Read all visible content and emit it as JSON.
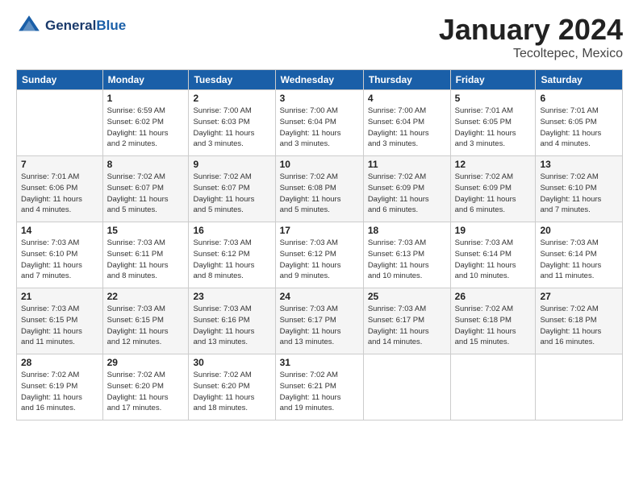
{
  "header": {
    "logo_line1": "General",
    "logo_line2": "Blue",
    "month": "January 2024",
    "location": "Tecoltepec, Mexico"
  },
  "days_of_week": [
    "Sunday",
    "Monday",
    "Tuesday",
    "Wednesday",
    "Thursday",
    "Friday",
    "Saturday"
  ],
  "weeks": [
    [
      {
        "day": "",
        "info": ""
      },
      {
        "day": "1",
        "info": "Sunrise: 6:59 AM\nSunset: 6:02 PM\nDaylight: 11 hours\nand 2 minutes."
      },
      {
        "day": "2",
        "info": "Sunrise: 7:00 AM\nSunset: 6:03 PM\nDaylight: 11 hours\nand 3 minutes."
      },
      {
        "day": "3",
        "info": "Sunrise: 7:00 AM\nSunset: 6:04 PM\nDaylight: 11 hours\nand 3 minutes."
      },
      {
        "day": "4",
        "info": "Sunrise: 7:00 AM\nSunset: 6:04 PM\nDaylight: 11 hours\nand 3 minutes."
      },
      {
        "day": "5",
        "info": "Sunrise: 7:01 AM\nSunset: 6:05 PM\nDaylight: 11 hours\nand 3 minutes."
      },
      {
        "day": "6",
        "info": "Sunrise: 7:01 AM\nSunset: 6:05 PM\nDaylight: 11 hours\nand 4 minutes."
      }
    ],
    [
      {
        "day": "7",
        "info": "Sunrise: 7:01 AM\nSunset: 6:06 PM\nDaylight: 11 hours\nand 4 minutes."
      },
      {
        "day": "8",
        "info": "Sunrise: 7:02 AM\nSunset: 6:07 PM\nDaylight: 11 hours\nand 5 minutes."
      },
      {
        "day": "9",
        "info": "Sunrise: 7:02 AM\nSunset: 6:07 PM\nDaylight: 11 hours\nand 5 minutes."
      },
      {
        "day": "10",
        "info": "Sunrise: 7:02 AM\nSunset: 6:08 PM\nDaylight: 11 hours\nand 5 minutes."
      },
      {
        "day": "11",
        "info": "Sunrise: 7:02 AM\nSunset: 6:09 PM\nDaylight: 11 hours\nand 6 minutes."
      },
      {
        "day": "12",
        "info": "Sunrise: 7:02 AM\nSunset: 6:09 PM\nDaylight: 11 hours\nand 6 minutes."
      },
      {
        "day": "13",
        "info": "Sunrise: 7:02 AM\nSunset: 6:10 PM\nDaylight: 11 hours\nand 7 minutes."
      }
    ],
    [
      {
        "day": "14",
        "info": "Sunrise: 7:03 AM\nSunset: 6:10 PM\nDaylight: 11 hours\nand 7 minutes."
      },
      {
        "day": "15",
        "info": "Sunrise: 7:03 AM\nSunset: 6:11 PM\nDaylight: 11 hours\nand 8 minutes."
      },
      {
        "day": "16",
        "info": "Sunrise: 7:03 AM\nSunset: 6:12 PM\nDaylight: 11 hours\nand 8 minutes."
      },
      {
        "day": "17",
        "info": "Sunrise: 7:03 AM\nSunset: 6:12 PM\nDaylight: 11 hours\nand 9 minutes."
      },
      {
        "day": "18",
        "info": "Sunrise: 7:03 AM\nSunset: 6:13 PM\nDaylight: 11 hours\nand 10 minutes."
      },
      {
        "day": "19",
        "info": "Sunrise: 7:03 AM\nSunset: 6:14 PM\nDaylight: 11 hours\nand 10 minutes."
      },
      {
        "day": "20",
        "info": "Sunrise: 7:03 AM\nSunset: 6:14 PM\nDaylight: 11 hours\nand 11 minutes."
      }
    ],
    [
      {
        "day": "21",
        "info": "Sunrise: 7:03 AM\nSunset: 6:15 PM\nDaylight: 11 hours\nand 11 minutes."
      },
      {
        "day": "22",
        "info": "Sunrise: 7:03 AM\nSunset: 6:15 PM\nDaylight: 11 hours\nand 12 minutes."
      },
      {
        "day": "23",
        "info": "Sunrise: 7:03 AM\nSunset: 6:16 PM\nDaylight: 11 hours\nand 13 minutes."
      },
      {
        "day": "24",
        "info": "Sunrise: 7:03 AM\nSunset: 6:17 PM\nDaylight: 11 hours\nand 13 minutes."
      },
      {
        "day": "25",
        "info": "Sunrise: 7:03 AM\nSunset: 6:17 PM\nDaylight: 11 hours\nand 14 minutes."
      },
      {
        "day": "26",
        "info": "Sunrise: 7:02 AM\nSunset: 6:18 PM\nDaylight: 11 hours\nand 15 minutes."
      },
      {
        "day": "27",
        "info": "Sunrise: 7:02 AM\nSunset: 6:18 PM\nDaylight: 11 hours\nand 16 minutes."
      }
    ],
    [
      {
        "day": "28",
        "info": "Sunrise: 7:02 AM\nSunset: 6:19 PM\nDaylight: 11 hours\nand 16 minutes."
      },
      {
        "day": "29",
        "info": "Sunrise: 7:02 AM\nSunset: 6:20 PM\nDaylight: 11 hours\nand 17 minutes."
      },
      {
        "day": "30",
        "info": "Sunrise: 7:02 AM\nSunset: 6:20 PM\nDaylight: 11 hours\nand 18 minutes."
      },
      {
        "day": "31",
        "info": "Sunrise: 7:02 AM\nSunset: 6:21 PM\nDaylight: 11 hours\nand 19 minutes."
      },
      {
        "day": "",
        "info": ""
      },
      {
        "day": "",
        "info": ""
      },
      {
        "day": "",
        "info": ""
      }
    ]
  ]
}
